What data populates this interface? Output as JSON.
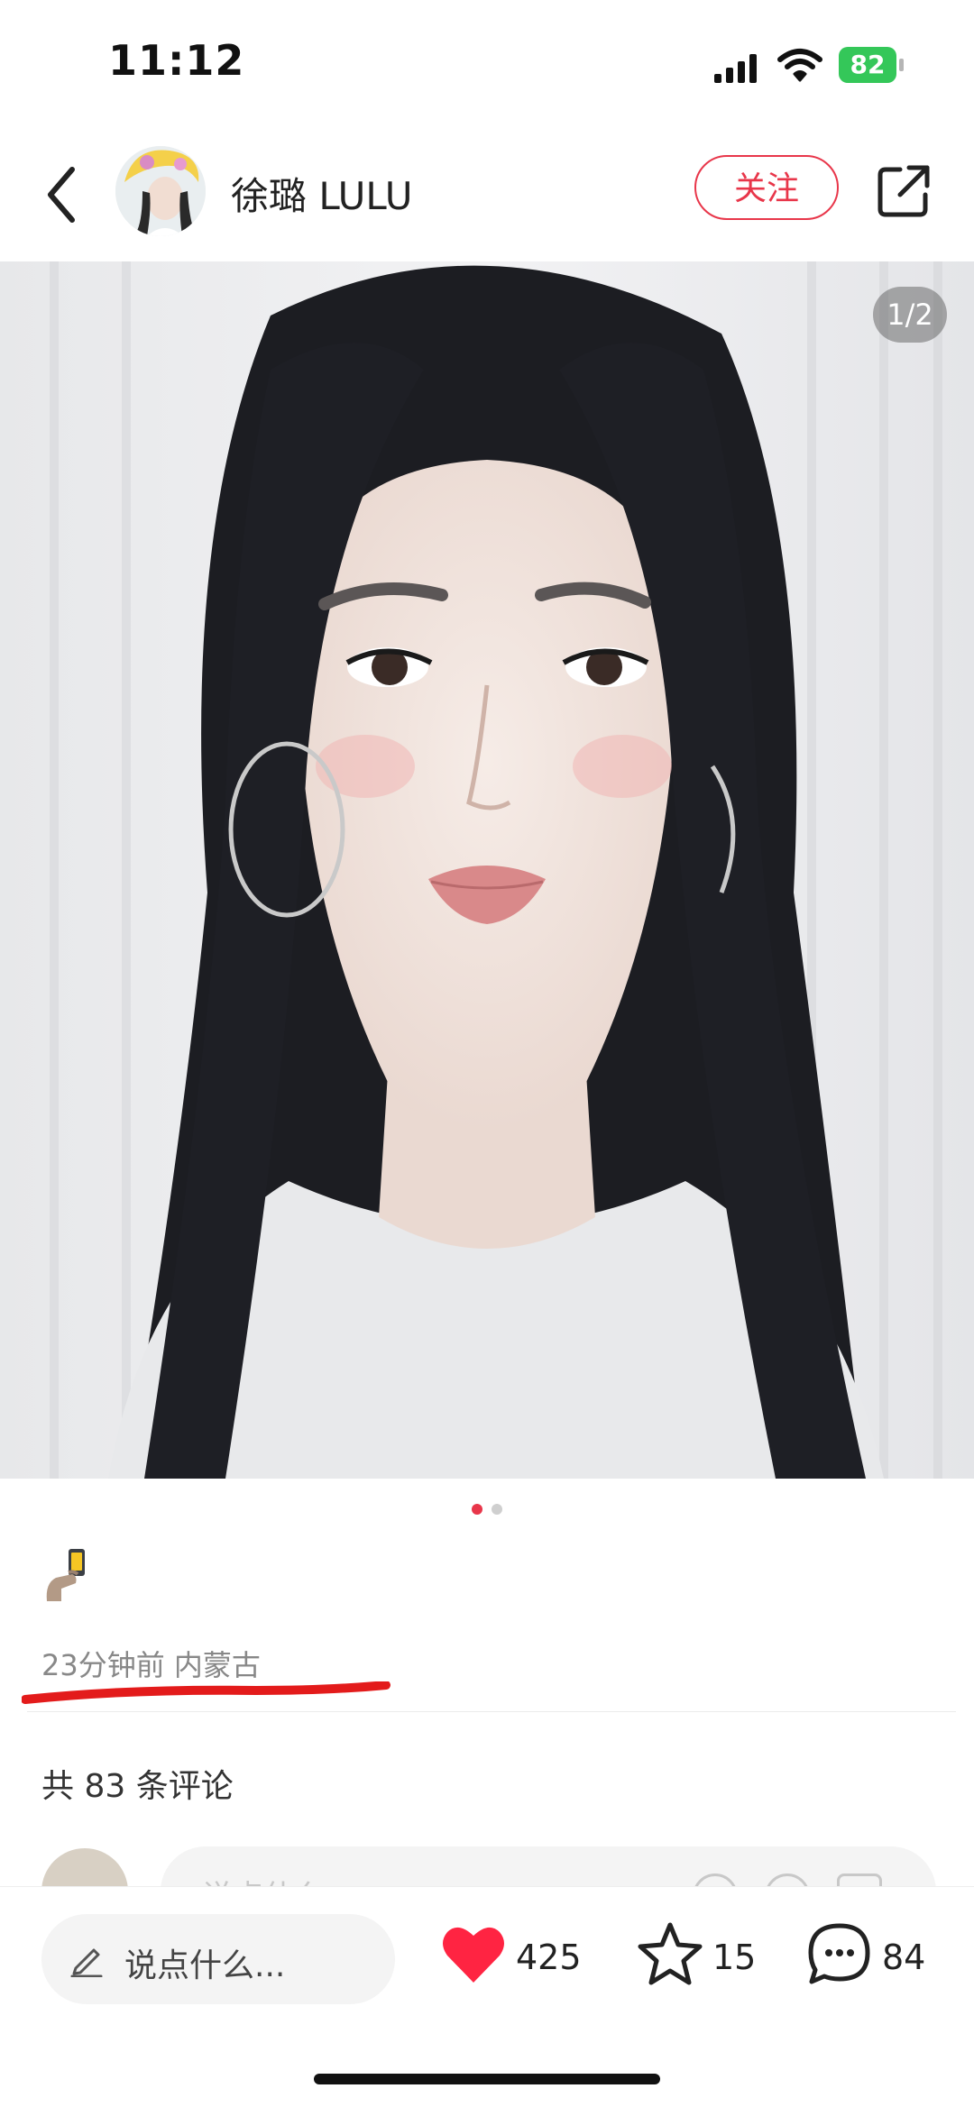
{
  "status_bar": {
    "time": "11:12",
    "battery": "82",
    "icons": [
      "signal-icon",
      "wifi-icon",
      "battery-icon"
    ]
  },
  "header": {
    "back_icon": "chevron-left-icon",
    "username": "徐璐 LULU",
    "follow_label": "关注",
    "share_icon": "share-icon"
  },
  "post": {
    "page_counter": "1/2",
    "current_page": 1,
    "total_pages": 2,
    "emoji": "🤳",
    "meta": "23分钟前 内蒙古",
    "annotation_color": "#e31b1b"
  },
  "comments": {
    "count_label": "共 83 条评论",
    "input_placeholder": "说点什么"
  },
  "bottom_bar": {
    "say_placeholder": "说点什么...",
    "likes": "425",
    "favorites": "15",
    "comments": "84"
  },
  "colors": {
    "accent": "#e8364a",
    "like": "#ff2442",
    "battery": "#34c759"
  }
}
